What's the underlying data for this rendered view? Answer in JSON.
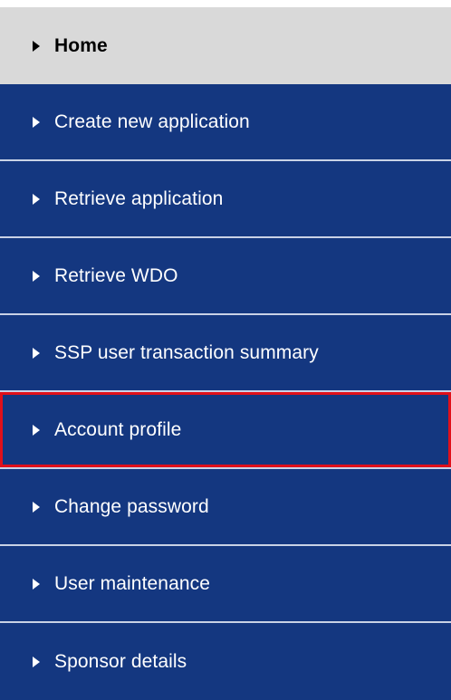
{
  "nav": {
    "items": [
      {
        "label": "Home",
        "icon": "triangle-right-icon",
        "state": "active"
      },
      {
        "label": "Create new application",
        "icon": "triangle-right-icon"
      },
      {
        "label": "Retrieve application",
        "icon": "triangle-right-icon"
      },
      {
        "label": "Retrieve WDO",
        "icon": "triangle-right-icon"
      },
      {
        "label": "SSP user transaction summary",
        "icon": "triangle-right-icon"
      },
      {
        "label": "Account profile",
        "icon": "triangle-right-icon",
        "state": "highlighted"
      },
      {
        "label": "Change password",
        "icon": "triangle-right-icon"
      },
      {
        "label": "User maintenance",
        "icon": "triangle-right-icon"
      },
      {
        "label": "Sponsor details",
        "icon": "triangle-right-icon"
      }
    ]
  },
  "colors": {
    "item_background": "#143780",
    "active_background": "#d9d9d9",
    "highlight_border": "#e0101a",
    "separator": "#c9d2e6"
  }
}
